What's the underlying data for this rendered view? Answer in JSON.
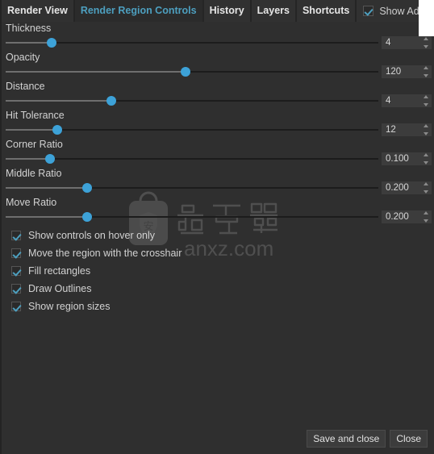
{
  "window": {
    "background_color": "#2f2f2f",
    "accent_color": "#4d9fbf",
    "handle_color": "#3da2d8"
  },
  "tabs": [
    {
      "label": "Render View",
      "active": false
    },
    {
      "label": "Render Region Controls",
      "active": true
    },
    {
      "label": "History",
      "active": false
    },
    {
      "label": "Layers",
      "active": false
    },
    {
      "label": "Shortcuts",
      "active": false
    }
  ],
  "advanced_settings": {
    "label": "Show Advanced Settin",
    "checked": true
  },
  "sliders": [
    {
      "label": "Thickness",
      "value": "4",
      "handle_pct": 11
    },
    {
      "label": "Opacity",
      "value": "120",
      "handle_pct": 47
    },
    {
      "label": "Distance",
      "value": "4",
      "handle_pct": 27
    },
    {
      "label": "Hit Tolerance",
      "value": "12",
      "handle_pct": 12.5
    },
    {
      "label": "Corner Ratio",
      "value": "0.100",
      "handle_pct": 10.5
    },
    {
      "label": "Middle Ratio",
      "value": "0.200",
      "handle_pct": 20.5
    },
    {
      "label": "Move Ratio",
      "value": "0.200",
      "handle_pct": 20.5
    }
  ],
  "checkboxes": [
    {
      "label": "Show controls on hover only",
      "checked": true
    },
    {
      "label": "Move the region with the crosshair",
      "checked": true
    },
    {
      "label": "Fill rectangles",
      "checked": true
    },
    {
      "label": "Draw Outlines",
      "checked": true
    },
    {
      "label": "Show region sizes",
      "checked": true
    }
  ],
  "footer": {
    "save_label": "Save and close",
    "close_label": "Close"
  },
  "watermark": {
    "site_text": "anxz.com",
    "badge_char": "安"
  }
}
